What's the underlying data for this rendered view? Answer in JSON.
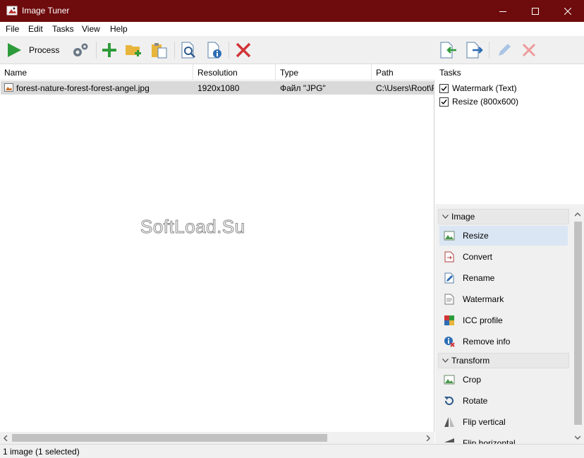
{
  "window": {
    "title": "Image Tuner"
  },
  "menu": [
    "File",
    "Edit",
    "Tasks",
    "View",
    "Help"
  ],
  "toolbar": {
    "process_label": "Process",
    "icons": [
      "play-icon",
      "gears-icon",
      "add-icon",
      "add-folder-icon",
      "paste-icon",
      "preview-icon",
      "info-icon",
      "remove-icon",
      "import-tasks-icon",
      "export-tasks-icon",
      "edit-icon",
      "delete-task-icon"
    ]
  },
  "files": {
    "columns": [
      "Name",
      "Resolution",
      "Type",
      "Path"
    ],
    "rows": [
      {
        "name": "forest-nature-forest-forest-angel.jpg",
        "resolution": "1920x1080",
        "type": "Файл \"JPG\"",
        "path": "C:\\Users\\Root\\F"
      }
    ]
  },
  "watermark_text": "SoftLoad.Su",
  "tasks": {
    "header": "Tasks",
    "items": [
      {
        "label": "Watermark (Text)",
        "checked": true
      },
      {
        "label": "Resize (800x600)",
        "checked": true
      }
    ]
  },
  "actions": {
    "groups": [
      {
        "label": "Image",
        "items": [
          "Resize",
          "Convert",
          "Rename",
          "Watermark",
          "ICC profile",
          "Remove info"
        ]
      },
      {
        "label": "Transform",
        "items": [
          "Crop",
          "Rotate",
          "Flip vertical",
          "Flip horizontal"
        ]
      }
    ],
    "selected": "Resize"
  },
  "status": "1 image (1 selected)",
  "colors": {
    "titlebar": "#6e0b0d",
    "accent_green": "#2e9b3a",
    "accent_red": "#d13438",
    "selection": "#dbe6f4"
  }
}
